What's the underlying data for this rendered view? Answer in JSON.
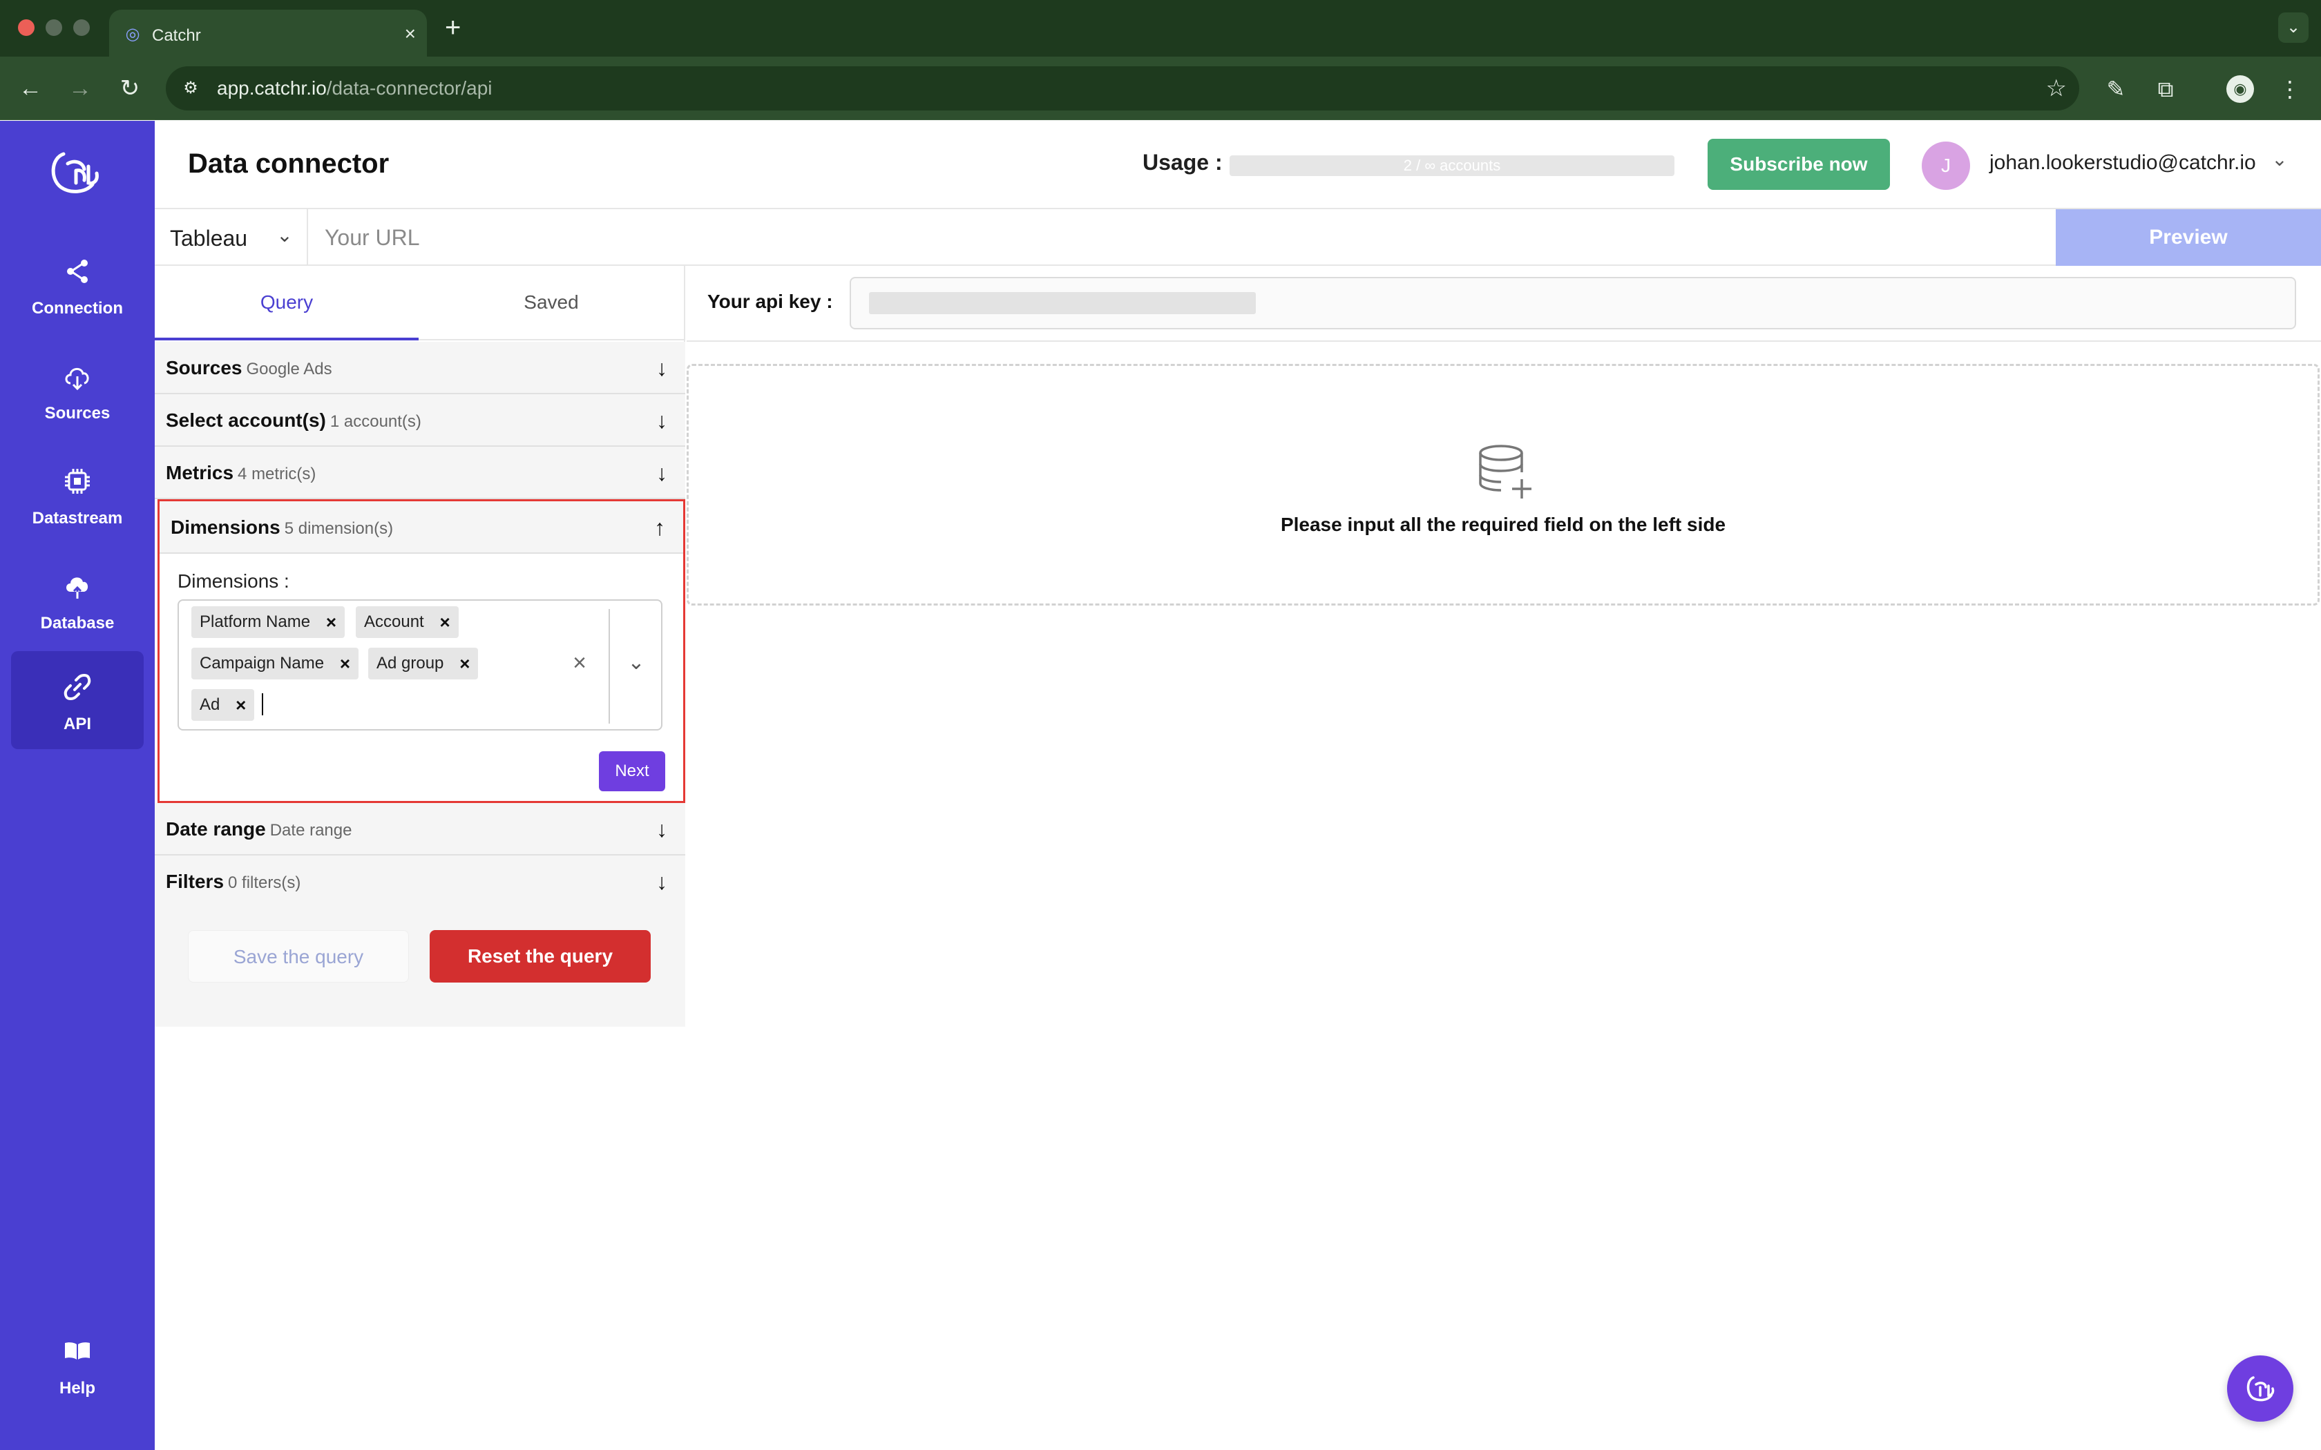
{
  "browser": {
    "tab_title": "Catchr",
    "url_host": "app.catchr.io",
    "url_path": "/data-connector/api"
  },
  "sidebar": {
    "items": [
      {
        "label": "Connection",
        "icon": "share-icon"
      },
      {
        "label": "Sources",
        "icon": "cloud-download-icon"
      },
      {
        "label": "Datastream",
        "icon": "chip-icon"
      },
      {
        "label": "Database",
        "icon": "cloud-upload-icon"
      },
      {
        "label": "API",
        "icon": "link-icon",
        "active": true
      },
      {
        "label": "Help",
        "icon": "book-icon"
      }
    ]
  },
  "header": {
    "title": "Data connector",
    "usage_label": "Usage :",
    "usage_value": "2 / ∞ accounts",
    "subscribe_label": "Subscribe now",
    "avatar_initial": "J",
    "user_email": "johan.lookerstudio@catchr.io"
  },
  "urlrow": {
    "tool_selected": "Tableau",
    "url_placeholder": "Your URL",
    "preview_label": "Preview"
  },
  "query_panel": {
    "tabs": [
      "Query",
      "Saved"
    ],
    "sections": [
      {
        "title": "Sources",
        "sub": "Google Ads"
      },
      {
        "title": "Select account(s)",
        "sub": "1 account(s)"
      },
      {
        "title": "Metrics",
        "sub": "4 metric(s)"
      },
      {
        "title": "Dimensions",
        "sub": "5 dimension(s)"
      },
      {
        "title": "Date range",
        "sub": "Date range"
      },
      {
        "title": "Filters",
        "sub": "0 filters(s)"
      }
    ],
    "dimensions": {
      "field_label": "Dimensions :",
      "chips": [
        "Platform Name",
        "Account",
        "Campaign Name",
        "Ad group",
        "Ad"
      ],
      "next_label": "Next"
    },
    "save_label": "Save the query",
    "reset_label": "Reset the query"
  },
  "api": {
    "key_label": "Your api key :",
    "empty_message": "Please input all the required field on the left side"
  },
  "colors": {
    "sidebar": "#4a3fd1",
    "accent": "#6f3ee0",
    "subscribe": "#4caf7a",
    "reset": "#d32f2f",
    "highlight": "#e53935"
  }
}
